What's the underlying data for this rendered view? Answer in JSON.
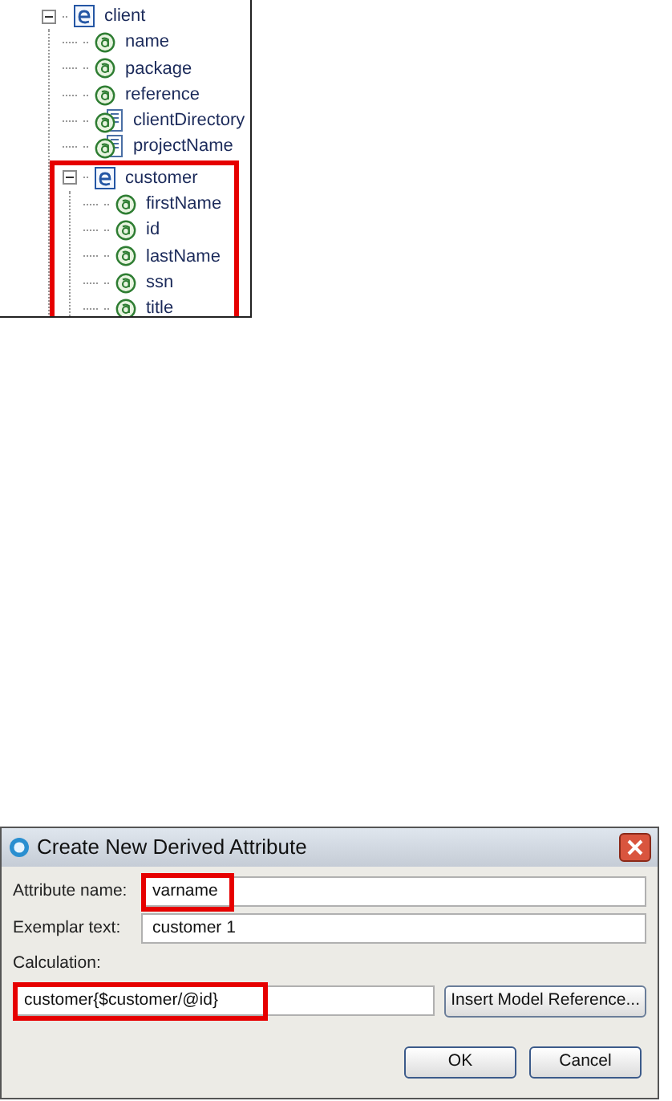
{
  "tree": [
    {
      "label": "client",
      "kind": "element",
      "expanded": true,
      "highlighted": false,
      "children": [
        {
          "label": "name",
          "kind": "attribute"
        },
        {
          "label": "package",
          "kind": "attribute"
        },
        {
          "label": "reference",
          "kind": "attribute"
        },
        {
          "label": "clientDirectory",
          "kind": "derived"
        },
        {
          "label": "projectName",
          "kind": "derived"
        },
        {
          "label": "customer",
          "kind": "element",
          "expanded": true,
          "highlighted": true,
          "children": [
            {
              "label": "firstName",
              "kind": "attribute"
            },
            {
              "label": "id",
              "kind": "attribute"
            },
            {
              "label": "lastName",
              "kind": "attribute"
            },
            {
              "label": "ssn",
              "kind": "attribute"
            },
            {
              "label": "title",
              "kind": "attribute"
            }
          ]
        }
      ]
    }
  ],
  "dialog": {
    "title": "Create New Derived Attribute",
    "fields": [
      {
        "label": "Attribute name:",
        "value": "varname",
        "highlighted": true
      },
      {
        "label": "Exemplar text:",
        "value": "customer 1",
        "highlighted": false
      }
    ],
    "calculation": {
      "label": "Calculation:",
      "value": "customer{$customer/@id}",
      "highlighted": true,
      "button": "Insert Model Reference..."
    },
    "buttons": [
      "OK",
      "Cancel"
    ]
  }
}
